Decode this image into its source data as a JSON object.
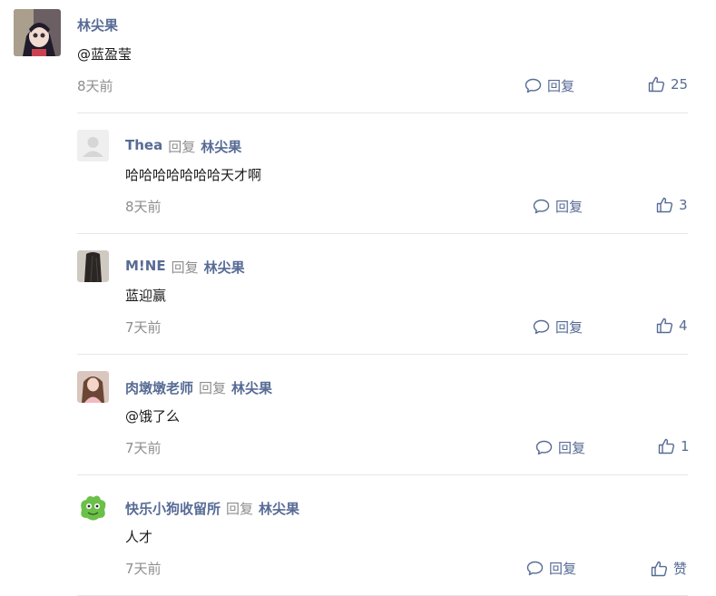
{
  "colors": {
    "link": "#576b95",
    "muted": "#8e8e8e",
    "text": "#1a1a1a",
    "divider": "#e6e6e6"
  },
  "main_comment": {
    "author": "林尖果",
    "text": "@蓝盈莹",
    "time": "8天前",
    "reply_label": "回复",
    "like_count": "25"
  },
  "replies": [
    {
      "author": "Thea",
      "reply_word": "回复",
      "reply_to": "林尖果",
      "text": "哈哈哈哈哈哈哈天才啊",
      "time": "8天前",
      "reply_label": "回复",
      "like_count": "3"
    },
    {
      "author": "M!NE",
      "reply_word": "回复",
      "reply_to": "林尖果",
      "text": "蓝迎赢",
      "time": "7天前",
      "reply_label": "回复",
      "like_count": "4"
    },
    {
      "author": "肉墩墩老师",
      "reply_word": "回复",
      "reply_to": "林尖果",
      "text": "@饿了么",
      "time": "7天前",
      "reply_label": "回复",
      "like_count": "1"
    },
    {
      "author": "快乐小狗收留所",
      "reply_word": "回复",
      "reply_to": "林尖果",
      "text": "人才",
      "time": "7天前",
      "reply_label": "回复",
      "like_count": "赞"
    }
  ]
}
